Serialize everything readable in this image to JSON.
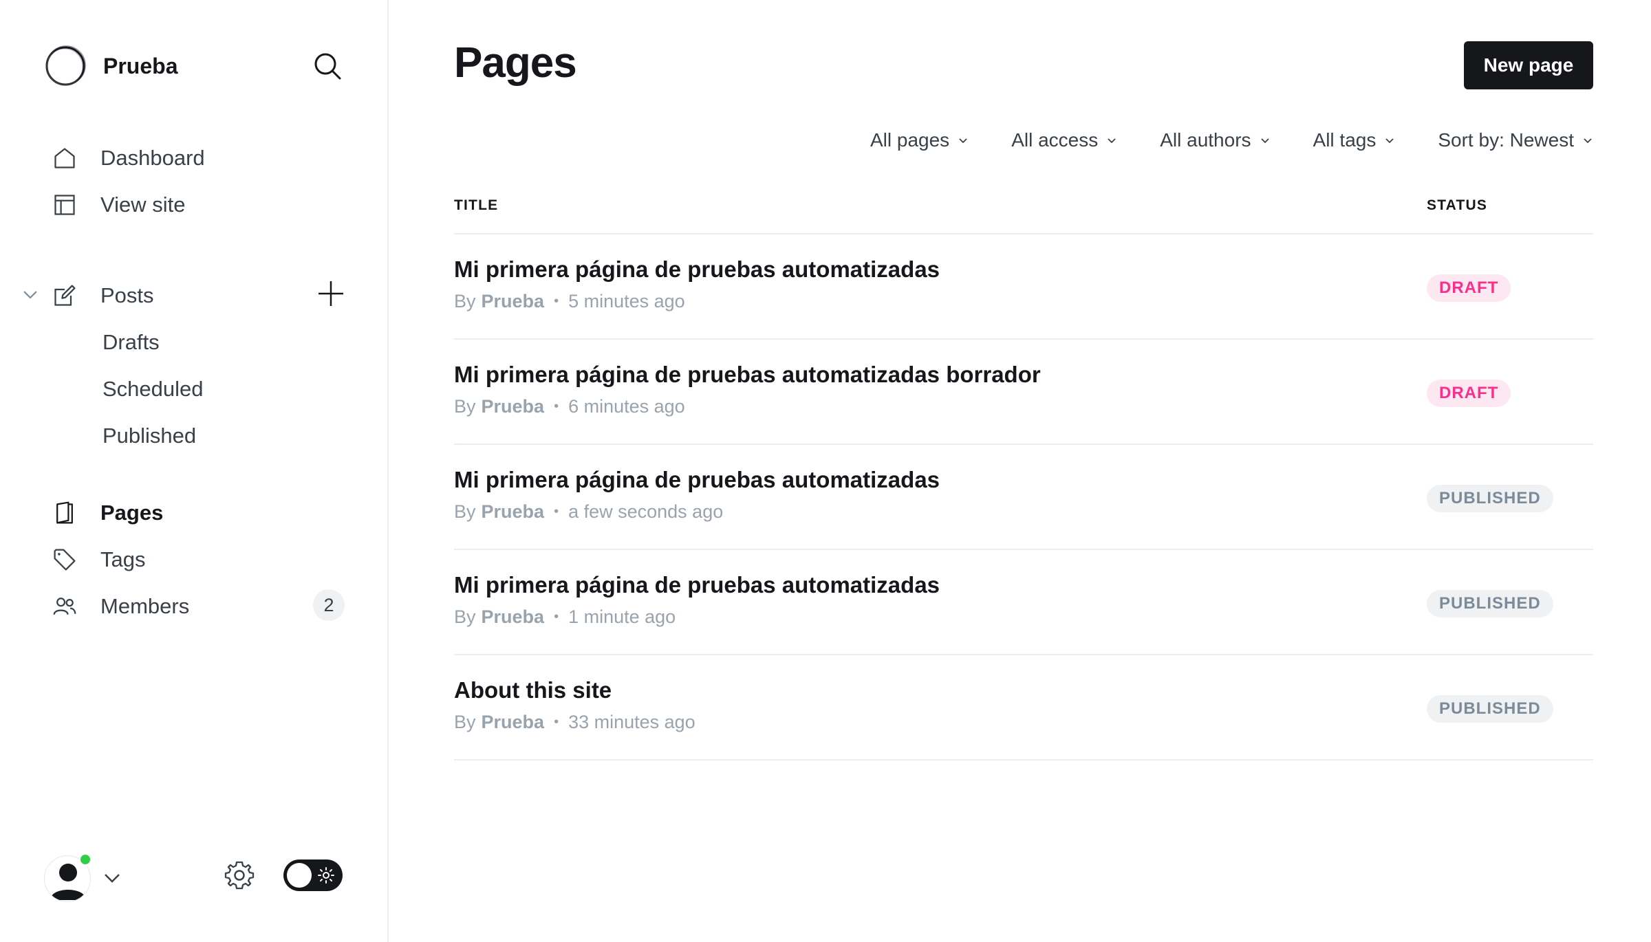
{
  "brand": {
    "name": "Prueba"
  },
  "sidebar": {
    "nav": [
      {
        "label": "Dashboard",
        "icon": "home-icon"
      },
      {
        "label": "View site",
        "icon": "layout-icon"
      }
    ],
    "posts": {
      "label": "Posts",
      "icon": "edit-icon",
      "sub_items": [
        "Drafts",
        "Scheduled",
        "Published"
      ]
    },
    "sections": [
      {
        "label": "Pages",
        "icon": "book-icon",
        "active": true
      },
      {
        "label": "Tags",
        "icon": "tag-icon"
      },
      {
        "label": "Members",
        "icon": "users-icon",
        "count": "2"
      }
    ]
  },
  "main": {
    "title": "Pages",
    "new_button": "New page",
    "filters": [
      "All pages",
      "All access",
      "All authors",
      "All tags",
      "Sort by: Newest"
    ],
    "columns": {
      "title": "TITLE",
      "status": "STATUS"
    },
    "rows": [
      {
        "title": "Mi primera página de pruebas automatizadas",
        "by": "By",
        "author": "Prueba",
        "time": "5 minutes ago",
        "status": "DRAFT"
      },
      {
        "title": "Mi primera página de pruebas automatizadas borrador",
        "by": "By",
        "author": "Prueba",
        "time": "6 minutes ago",
        "status": "DRAFT"
      },
      {
        "title": "Mi primera página de pruebas automatizadas",
        "by": "By",
        "author": "Prueba",
        "time": "a few seconds ago",
        "status": "PUBLISHED"
      },
      {
        "title": "Mi primera página de pruebas automatizadas",
        "by": "By",
        "author": "Prueba",
        "time": "1 minute ago",
        "status": "PUBLISHED"
      },
      {
        "title": "About this site",
        "by": "By",
        "author": "Prueba",
        "time": "33 minutes ago",
        "status": "PUBLISHED"
      }
    ]
  },
  "colors": {
    "primary": "#15171a",
    "draft_text": "#fb2d8d",
    "draft_bg": "#fde8f1",
    "published_text": "#7c8b9a",
    "published_bg": "#eff1f3",
    "online": "#30cf43"
  }
}
